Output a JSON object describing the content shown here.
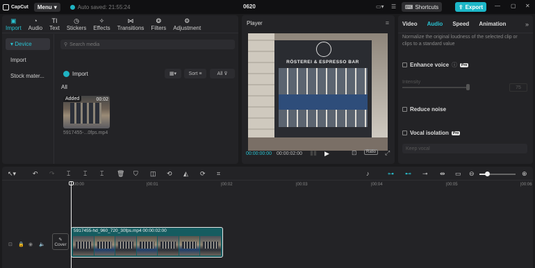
{
  "titlebar": {
    "app_name": "CapCut",
    "menu_label": "Menu",
    "autosave": "Auto saved: 21:55:24",
    "project_title": "0620",
    "shortcuts_label": "Shortcuts",
    "export_label": "Export"
  },
  "media_tabs": [
    {
      "label": "Import",
      "icon": "import-icon",
      "active": true
    },
    {
      "label": "Audio",
      "icon": "audio-icon"
    },
    {
      "label": "Text",
      "icon": "text-icon"
    },
    {
      "label": "Stickers",
      "icon": "stickers-icon"
    },
    {
      "label": "Effects",
      "icon": "effects-icon"
    },
    {
      "label": "Transitions",
      "icon": "transitions-icon"
    },
    {
      "label": "Filters",
      "icon": "filters-icon"
    },
    {
      "label": "Adjustment",
      "icon": "adjustment-icon"
    }
  ],
  "sidebar": {
    "items": [
      {
        "label": "▾ Device",
        "active": true
      },
      {
        "label": "Import"
      },
      {
        "label": "Stock mater..."
      }
    ]
  },
  "media": {
    "search_placeholder": "Search media",
    "import_label": "Import",
    "sort_label": "Sort",
    "all_filter": "All",
    "section_label": "All",
    "item": {
      "badge": "Added",
      "duration": "00:02",
      "name": "5917455-...0fps.mp4"
    }
  },
  "player": {
    "title": "Player",
    "sign_text": "RÖSTEREI & ESPRESSO BAR",
    "current_time": "00:00:00:00",
    "total_time": "00:00:02:00",
    "ratio_label": "Ratio"
  },
  "details": {
    "tabs": [
      "Video",
      "Audio",
      "Speed",
      "Animation"
    ],
    "active_tab": "Audio",
    "normalize_desc": "Normalize the original loudness of the selected clip or clips to a standard value",
    "reduce_vocal": "Enhance voice",
    "pro_badge": "Pro",
    "intensity_label": "Intensity",
    "intensity_value": "75",
    "reduce_noise": "Reduce noise",
    "vocal_isolation": "Vocal isolation",
    "keep_vocal": "Keep vocal"
  },
  "timeline": {
    "ruler_labels": [
      "00:00",
      "|00:01",
      "|00:02",
      "|00:03",
      "|00:04",
      "|00:05",
      "|00:06"
    ],
    "cover_label": "Cover",
    "clip_label": "5917455-hd_960_720_30fps.mp4   00:00:02:00"
  },
  "colors": {
    "accent": "#29c3d2",
    "export": "#1cb6c7",
    "clip": "#155c60"
  }
}
